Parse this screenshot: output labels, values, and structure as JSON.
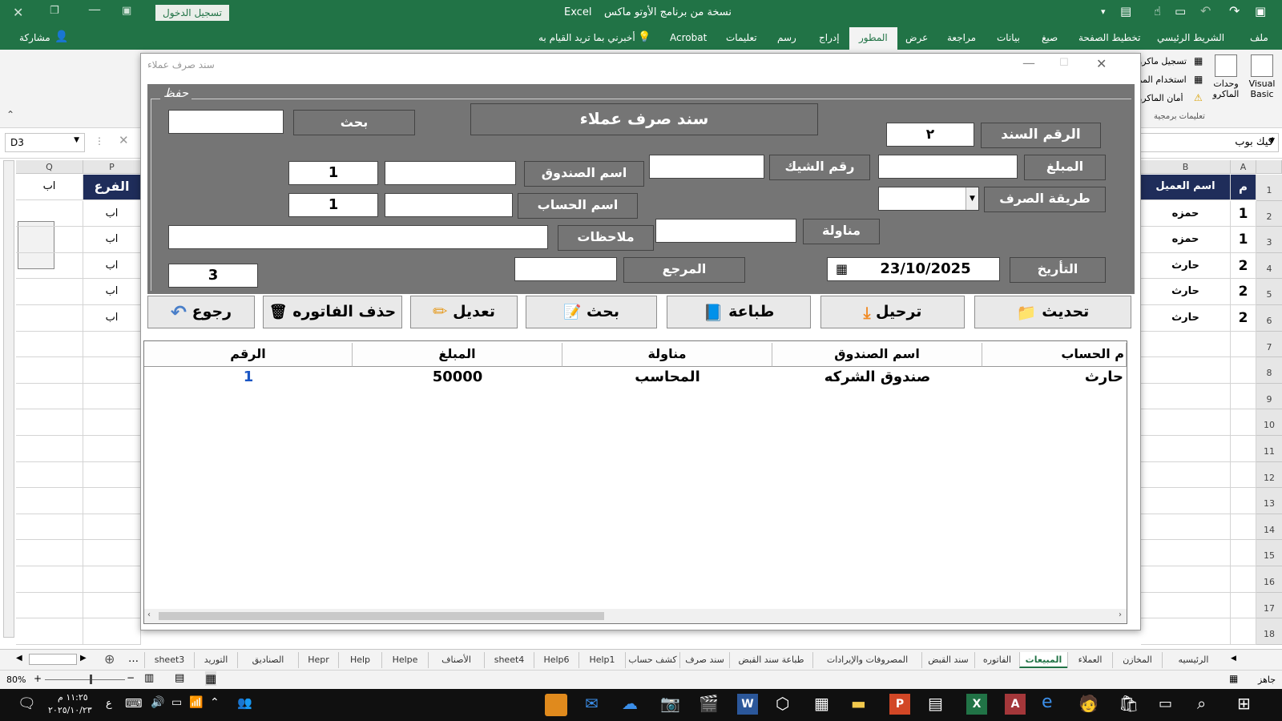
{
  "titlebar": {
    "signin_button": "تسجيل الدخول",
    "app_name": "Excel",
    "doc_title": "نسخة من برنامج الأوتو ماكس"
  },
  "ribbon": {
    "tabs": [
      "ملف",
      "الشريط الرئيسي",
      "تخطيط الصفحة",
      "صيغ",
      "بيانات",
      "مراجعة",
      "عرض",
      "المطور",
      "إدراج",
      "رسم",
      "تعليمات",
      "Acrobat"
    ],
    "active_tab": "المطور",
    "tell_me": "أخبرني بما تريد القيام به",
    "share": "مشاركة",
    "visual_basic": "Visual Basic",
    "macros": "وحدات الماكرو",
    "record_macro": "تسجيل ماكرو",
    "use_relative": "استخدام المر",
    "macro_security": "أمان الماكرو",
    "group_label": "تعليمات برمجية"
  },
  "formula_bar": {
    "name_box": "D3",
    "right_box": "كيك بوب"
  },
  "grid": {
    "col_headers_left": [
      "Q",
      "P"
    ],
    "col_headers_right": [
      "B",
      "A"
    ],
    "row_numbers": [
      "1",
      "2",
      "3",
      "4",
      "5",
      "6",
      "7",
      "8",
      "9",
      "10",
      "11",
      "12",
      "13",
      "14",
      "15",
      "16",
      "17",
      "18"
    ],
    "left_header_cells": [
      "اب",
      "الفرع"
    ],
    "left_rows": [
      [
        "",
        "اب"
      ],
      [
        "",
        "اب"
      ],
      [
        "",
        "اب"
      ],
      [
        "",
        "اب"
      ],
      [
        "",
        "اب"
      ]
    ],
    "right_header_cells": [
      "اسم العميل",
      "م"
    ],
    "right_rows": [
      [
        "حمزه",
        "1"
      ],
      [
        "حمزه",
        "1"
      ],
      [
        "حارث",
        "2"
      ],
      [
        "حارث",
        "2"
      ],
      [
        "حارث",
        "2"
      ]
    ]
  },
  "form": {
    "title": "سند صرف عملاء",
    "frame_label": "حفظ",
    "heading": "سند صرف عملاء",
    "search_label": "بحث",
    "search_value": "",
    "voucher_no_label": "الرقم السند",
    "voucher_no_value": "٢",
    "amount_label": "المبلغ",
    "amount_value": "",
    "cheque_label": "رقم الشيك",
    "cheque_value": "",
    "fund_label": "اسم الصندوق",
    "fund_value": "",
    "fund_code": "1",
    "payment_method_label": "طريقة الصرف",
    "payment_method_value": "",
    "account_label": "اسم الحساب",
    "account_value": "",
    "account_code": "1",
    "handler_label": "مناولة",
    "handler_value": "",
    "notes_label": "ملاحظات",
    "notes_value": "",
    "date_label": "التأريخ",
    "date_value": "23/10/2025",
    "reference_label": "المرجع",
    "reference_value": "",
    "counter_value": "3",
    "buttons": {
      "refresh": "تحديث",
      "post": "ترحيل",
      "print": "طباعة",
      "search": "بحث",
      "edit": "تعديل",
      "delete": "حذف الفاتوره",
      "back": "رجوع"
    },
    "list": {
      "headers": [
        "الرقم",
        "المبلغ",
        "مناولة",
        "اسم الصندوق",
        "م الحساب"
      ],
      "row": [
        "1",
        "50000",
        "المحاسب",
        "صندوق الشركه",
        "حارث"
      ]
    }
  },
  "sheet_tabs": [
    "sheet3",
    "التوريد",
    "الصناديق",
    "Hepr",
    "Help",
    "Helpe",
    "الأصناف",
    "sheet4",
    "Help6",
    "Help1",
    "كشف حساب",
    "سند صرف",
    "طباعة سند القبض",
    "المصروفات والإيرادات",
    "سند القبض",
    "الفاتوره",
    "المبيعات",
    "العملاء",
    "المخازن",
    "الرئيسيه"
  ],
  "active_sheet": "المبيعات",
  "statusbar": {
    "zoom": "80%",
    "ready": "جاهز"
  },
  "taskbar": {
    "time": "١١:٢٥ م",
    "date": "٢٠٢٥/١٠/٢٣",
    "lang": "ع"
  },
  "colors": {
    "excel_green": "#217346",
    "form_gray": "#757575",
    "header_navy": "#1f2d5a",
    "list_number_blue": "#1a56c4"
  }
}
